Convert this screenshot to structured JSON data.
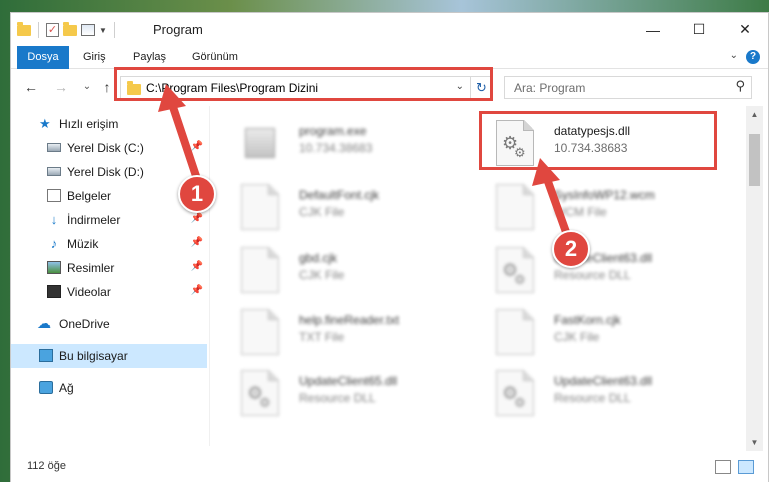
{
  "window": {
    "title": "Program",
    "minimize_glyph": "—",
    "maximize_glyph": "☐",
    "close_glyph": "✕"
  },
  "ribbon": {
    "tabs": [
      {
        "label": "Dosya"
      },
      {
        "label": "Giriş"
      },
      {
        "label": "Paylaş"
      },
      {
        "label": "Görünüm"
      }
    ],
    "help_glyph": "?"
  },
  "navbar": {
    "back_glyph": "←",
    "forward_glyph": "→",
    "recent_glyph": "⌄",
    "up_glyph": "↑",
    "address": "C:\\Program Files\\Program Dizini",
    "search_placeholder": "Ara: Program"
  },
  "sidebar": {
    "items": [
      {
        "label": "Hızlı erişim",
        "icon": "star-icon"
      },
      {
        "label": "Yerel Disk (C:)",
        "icon": "drive-icon"
      },
      {
        "label": "Yerel Disk (D:)",
        "icon": "drive-icon"
      },
      {
        "label": "Belgeler",
        "icon": "documents-icon"
      },
      {
        "label": "İndirmeler",
        "icon": "downloads-icon"
      },
      {
        "label": "Müzik",
        "icon": "music-icon"
      },
      {
        "label": "Resimler",
        "icon": "pictures-icon"
      },
      {
        "label": "Videolar",
        "icon": "videos-icon"
      },
      {
        "label": "OneDrive",
        "icon": "cloud-icon"
      },
      {
        "label": "Bu bilgisayar",
        "icon": "computer-icon"
      },
      {
        "label": "Ağ",
        "icon": "network-icon"
      }
    ]
  },
  "files": [
    {
      "name": "program.exe",
      "info": "10.734.38683",
      "kind": "exe",
      "blurred": true
    },
    {
      "name": "datatypesjs.dll",
      "info": "10.734.38683",
      "kind": "dll",
      "blurred": false
    },
    {
      "name": "DefaultFont.cjk",
      "info": "CJK File",
      "kind": "doc",
      "blurred": true
    },
    {
      "name": "SysInfoWP12.wcm",
      "info": "WCM File",
      "kind": "doc",
      "blurred": true
    },
    {
      "name": "gbd.cjk",
      "info": "CJK File",
      "kind": "doc",
      "blurred": true
    },
    {
      "name": "UpdateClient63.dll",
      "info": "Resource DLL",
      "kind": "dll",
      "blurred": true
    },
    {
      "name": "help.fineReader.txt",
      "info": "TXT File",
      "kind": "doc",
      "blurred": true
    },
    {
      "name": "FastKorn.cjk",
      "info": "CJK File",
      "kind": "doc",
      "blurred": true
    },
    {
      "name": "UpdateClient65.dll",
      "info": "Resource DLL",
      "kind": "dll",
      "blurred": true
    },
    {
      "name": "UpdateClient63.dll",
      "info": "Resource DLL",
      "kind": "dll",
      "blurred": true
    }
  ],
  "status": {
    "item_count": "112 öğe"
  },
  "callouts": [
    {
      "label": "1"
    },
    {
      "label": "2"
    }
  ],
  "colors": {
    "accent": "#1979ca",
    "selection": "#cce8ff",
    "annotation": "#e0473f"
  }
}
